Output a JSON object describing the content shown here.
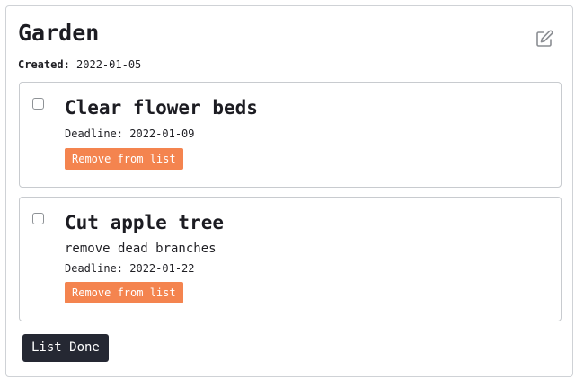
{
  "list": {
    "title": "Garden",
    "created_label": "Created:",
    "created_value": "2022-01-05",
    "edit_icon": "edit-icon"
  },
  "tasks": [
    {
      "title": "Clear flower beds",
      "description": "",
      "deadline": "Deadline: 2022-01-09",
      "remove_label": "Remove from list",
      "checked": false
    },
    {
      "title": "Cut apple tree",
      "description": "remove dead branches",
      "deadline": "Deadline: 2022-01-22",
      "remove_label": "Remove from list",
      "checked": false
    }
  ],
  "footer": {
    "done_label": "List Done"
  },
  "colors": {
    "remove_button": "#f4844f",
    "done_button": "#252833",
    "border": "#c8cbcf"
  }
}
